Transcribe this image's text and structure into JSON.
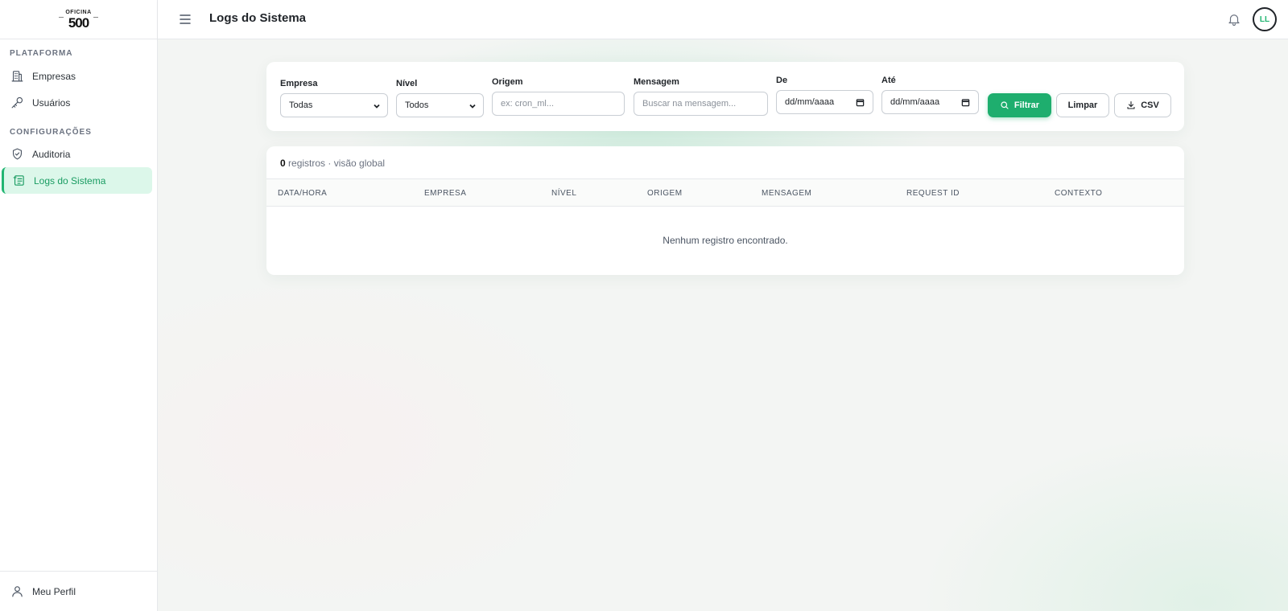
{
  "logo": {
    "top": "OFICINA",
    "bottom": "500"
  },
  "sidebar": {
    "sections": [
      {
        "label": "PLATAFORMA"
      },
      {
        "label": "CONFIGURAÇÕES"
      }
    ],
    "items": [
      {
        "label": "Empresas",
        "icon": "building-icon"
      },
      {
        "label": "Usuários",
        "icon": "key-icon"
      },
      {
        "label": "Auditoria",
        "icon": "shield-icon"
      },
      {
        "label": "Logs do Sistema",
        "icon": "scroll-icon",
        "active": true
      }
    ],
    "footer": {
      "label": "Meu Perfil",
      "icon": "user-icon"
    }
  },
  "header": {
    "title": "Logs do Sistema",
    "avatar": "LL"
  },
  "filters": {
    "empresa": {
      "label": "Empresa",
      "value": "Todas"
    },
    "nivel": {
      "label": "Nível",
      "value": "Todos"
    },
    "origem": {
      "label": "Origem",
      "placeholder": "ex: cron_ml..."
    },
    "mensagem": {
      "label": "Mensagem",
      "placeholder": "Buscar na mensagem..."
    },
    "de": {
      "label": "De",
      "placeholder": "dd/mm/aaaa"
    },
    "ate": {
      "label": "Até",
      "placeholder": "dd/mm/aaaa"
    },
    "filter_button": "Filtrar",
    "clear_button": "Limpar",
    "csv_button": "CSV"
  },
  "table": {
    "count": "0",
    "count_suffix": " registros · visão global",
    "columns": [
      "DATA/HORA",
      "EMPRESA",
      "NÍVEL",
      "ORIGEM",
      "MENSAGEM",
      "REQUEST ID",
      "CONTEXTO"
    ],
    "empty_message": "Nenhum registro encontrado."
  },
  "colors": {
    "accent": "#1eae6e",
    "active_bg": "#dcf7ea",
    "active_text": "#1a9c62"
  }
}
